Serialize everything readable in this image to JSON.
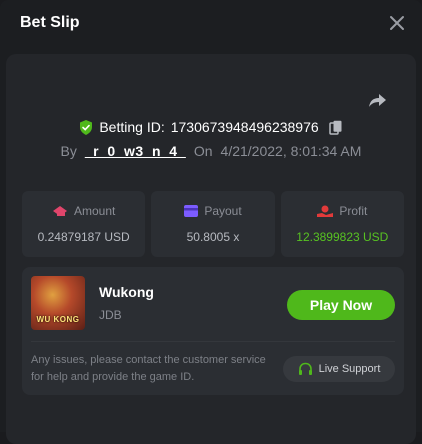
{
  "header": {
    "title": "Bet Slip"
  },
  "bet": {
    "id_label": "Betting ID:",
    "id_value": "1730673948496238976",
    "by_label": "By",
    "username": "_r_0_w3_n_4_",
    "on_label": "On",
    "datetime": "4/21/2022, 8:01:34 AM"
  },
  "stats": {
    "amount": {
      "label": "Amount",
      "value": "0.24879187 USD"
    },
    "payout": {
      "label": "Payout",
      "value": "50.8005 x"
    },
    "profit": {
      "label": "Profit",
      "value": "12.3899823 USD"
    }
  },
  "game": {
    "name": "Wukong",
    "provider": "JDB",
    "thumb_text": "WU KONG",
    "play_label": "Play Now"
  },
  "support": {
    "help_text": "Any issues, please contact the customer service for help and provide the game ID.",
    "button_label": "Live Support"
  },
  "colors": {
    "accent_green": "#4fb81b",
    "profit_green": "#58c322",
    "amount_icon": "#e0456b",
    "payout_icon": "#7c5cff",
    "profit_icon": "#e23a3a"
  }
}
